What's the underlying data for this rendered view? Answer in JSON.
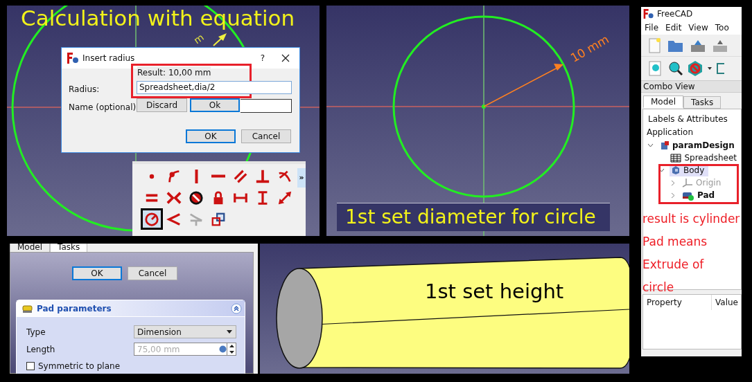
{
  "sketch_panel": {
    "caption": "Calculation with equation",
    "dimension_label": "m"
  },
  "dialog": {
    "title": "Insert radius",
    "help": "?",
    "result": "Result: 10,00 mm",
    "radius_label": "Radius:",
    "radius_value": "Spreadsheet,dia/2",
    "name_label": "Name (optional)",
    "popup_buttons": [
      "Discard",
      "Ok"
    ],
    "buttons": [
      {
        "label": "OK",
        "selected": true
      },
      {
        "label": "Cancel",
        "selected": false
      }
    ]
  },
  "toolbar": {
    "overflow": "»",
    "tools": [
      {
        "kind": "point",
        "selected": false,
        "disabled": false
      },
      {
        "kind": "coincident",
        "selected": false,
        "disabled": false
      },
      {
        "kind": "vertical",
        "selected": false,
        "disabled": false
      },
      {
        "kind": "horizontal",
        "selected": false,
        "disabled": false
      },
      {
        "kind": "parallel",
        "selected": false,
        "disabled": false
      },
      {
        "kind": "perpendicular",
        "selected": false,
        "disabled": false
      },
      {
        "kind": "tangent",
        "selected": false,
        "disabled": false
      },
      {
        "kind": "equal",
        "selected": false,
        "disabled": false
      },
      {
        "kind": "symmetric",
        "selected": false,
        "disabled": false
      },
      {
        "kind": "block",
        "selected": false,
        "disabled": false
      },
      {
        "kind": "lock",
        "selected": false,
        "disabled": false
      },
      {
        "kind": "hdistance",
        "selected": false,
        "disabled": false
      },
      {
        "kind": "vdistance",
        "selected": false,
        "disabled": false
      },
      {
        "kind": "distance",
        "selected": false,
        "disabled": false
      },
      {
        "kind": "radius",
        "selected": true,
        "disabled": false
      },
      {
        "kind": "angle",
        "selected": false,
        "disabled": false
      },
      {
        "kind": "snell",
        "selected": false,
        "disabled": true
      },
      {
        "kind": "internal",
        "selected": false,
        "disabled": false
      }
    ]
  },
  "circle_panel": {
    "dimension_label": "10 mm",
    "caption": "1st set diameter for circle"
  },
  "freecad": {
    "title": "FreeCAD",
    "menu": [
      "File",
      "Edit",
      "View",
      "Too"
    ],
    "combo_view": "Combo View",
    "tabs": [
      {
        "label": "Model",
        "selected": true
      },
      {
        "label": "Tasks",
        "selected": false
      }
    ],
    "tree_header": "Labels & Attributes",
    "tree": {
      "label": "Application",
      "children": [
        {
          "label": "paramDesign",
          "kind": "document",
          "bold": true,
          "expanded": true,
          "selected": false,
          "children": [
            {
              "label": "Spreadsheet",
              "kind": "spreadsheet",
              "bold": false,
              "selected": false
            },
            {
              "label": "Body",
              "kind": "body",
              "bold": false,
              "expanded": true,
              "selected": true,
              "children": [
                {
                  "label": "Origin",
                  "kind": "origin",
                  "bold": false,
                  "expanded": false,
                  "selected": false,
                  "disabled": true
                },
                {
                  "label": "Pad",
                  "kind": "pad",
                  "bold": true,
                  "expanded": false,
                  "selected": false,
                  "disabled": false
                }
              ]
            }
          ]
        }
      ]
    },
    "note": [
      "result is cylinder",
      "Pad means",
      "Extrude of",
      "circle"
    ],
    "property_columns": [
      "Property",
      "Value"
    ]
  },
  "task_panel": {
    "tabs": [
      {
        "label": "Model",
        "selected": false
      },
      {
        "label": "Tasks",
        "selected": true
      }
    ],
    "buttons": [
      {
        "label": "OK",
        "selected": true
      },
      {
        "label": "Cancel",
        "selected": false
      }
    ],
    "section_title": "Pad parameters",
    "type_label": "Type",
    "type_value": "Dimension",
    "length_label": "Length",
    "length_value": "75,00 mm",
    "symmetric": {
      "label": "Symmetric to plane",
      "checked": false
    }
  },
  "cylinder_panel": {
    "caption": "1st set height"
  }
}
